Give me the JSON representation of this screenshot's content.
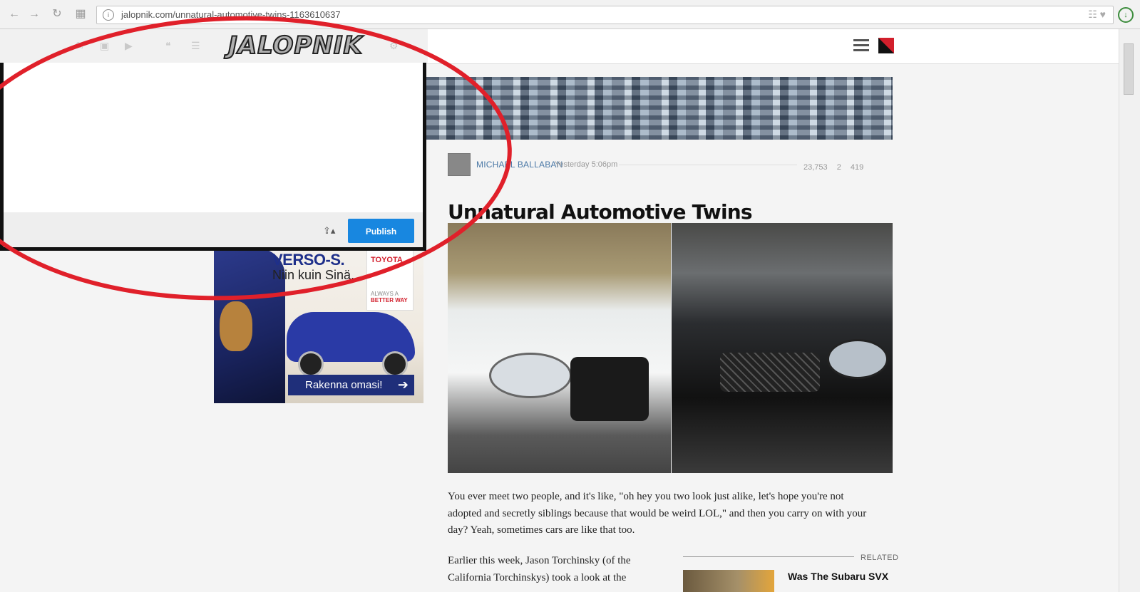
{
  "browser": {
    "url": "jalopnik.com/unnatural-automotive-twins-1163610637",
    "back_icon": "back-arrow-icon",
    "forward_icon": "forward-arrow-icon",
    "reload_icon": "reload-icon",
    "apps_icon": "apps-grid-icon"
  },
  "site": {
    "logo_text": "JALOPNIK",
    "menu_icon": "hamburger-menu-icon"
  },
  "editor": {
    "publish_label": "Publish",
    "share_icon": "share-icon",
    "toolbar_icons": [
      "link-icon",
      "image-icon",
      "video-icon",
      "quote-icon",
      "list-icon"
    ]
  },
  "ad": {
    "model": "VERSO-S.",
    "tagline": "Niin kuin Sinä.",
    "brand": "TOYOTA",
    "slogan_line1": "ALWAYS A",
    "slogan_line2": "BETTER WAY",
    "cta": "Rakenna omasi!"
  },
  "article": {
    "author": "MICHAEL BALLABAN",
    "time": "Yesterday 5:06pm",
    "views": "23,753",
    "likes": "2",
    "comments": "419",
    "title": "Unnatural Automotive Twins",
    "paragraph1": "You ever meet two people, and it's like, \"oh hey you two look just alike, let's hope you're not adopted and secretly siblings because that would be weird LOL,\" and then you carry on with your day? Yeah, sometimes cars are like that too.",
    "paragraph2": "Earlier this week, Jason Torchinsky (of the California Torchinskys) took a look at the",
    "related_label": "RELATED",
    "related_title": "Was The Subaru SVX"
  },
  "colors": {
    "accent": "#1887e0",
    "annotation": "#e0202a",
    "author_link": "#4a78a6"
  }
}
